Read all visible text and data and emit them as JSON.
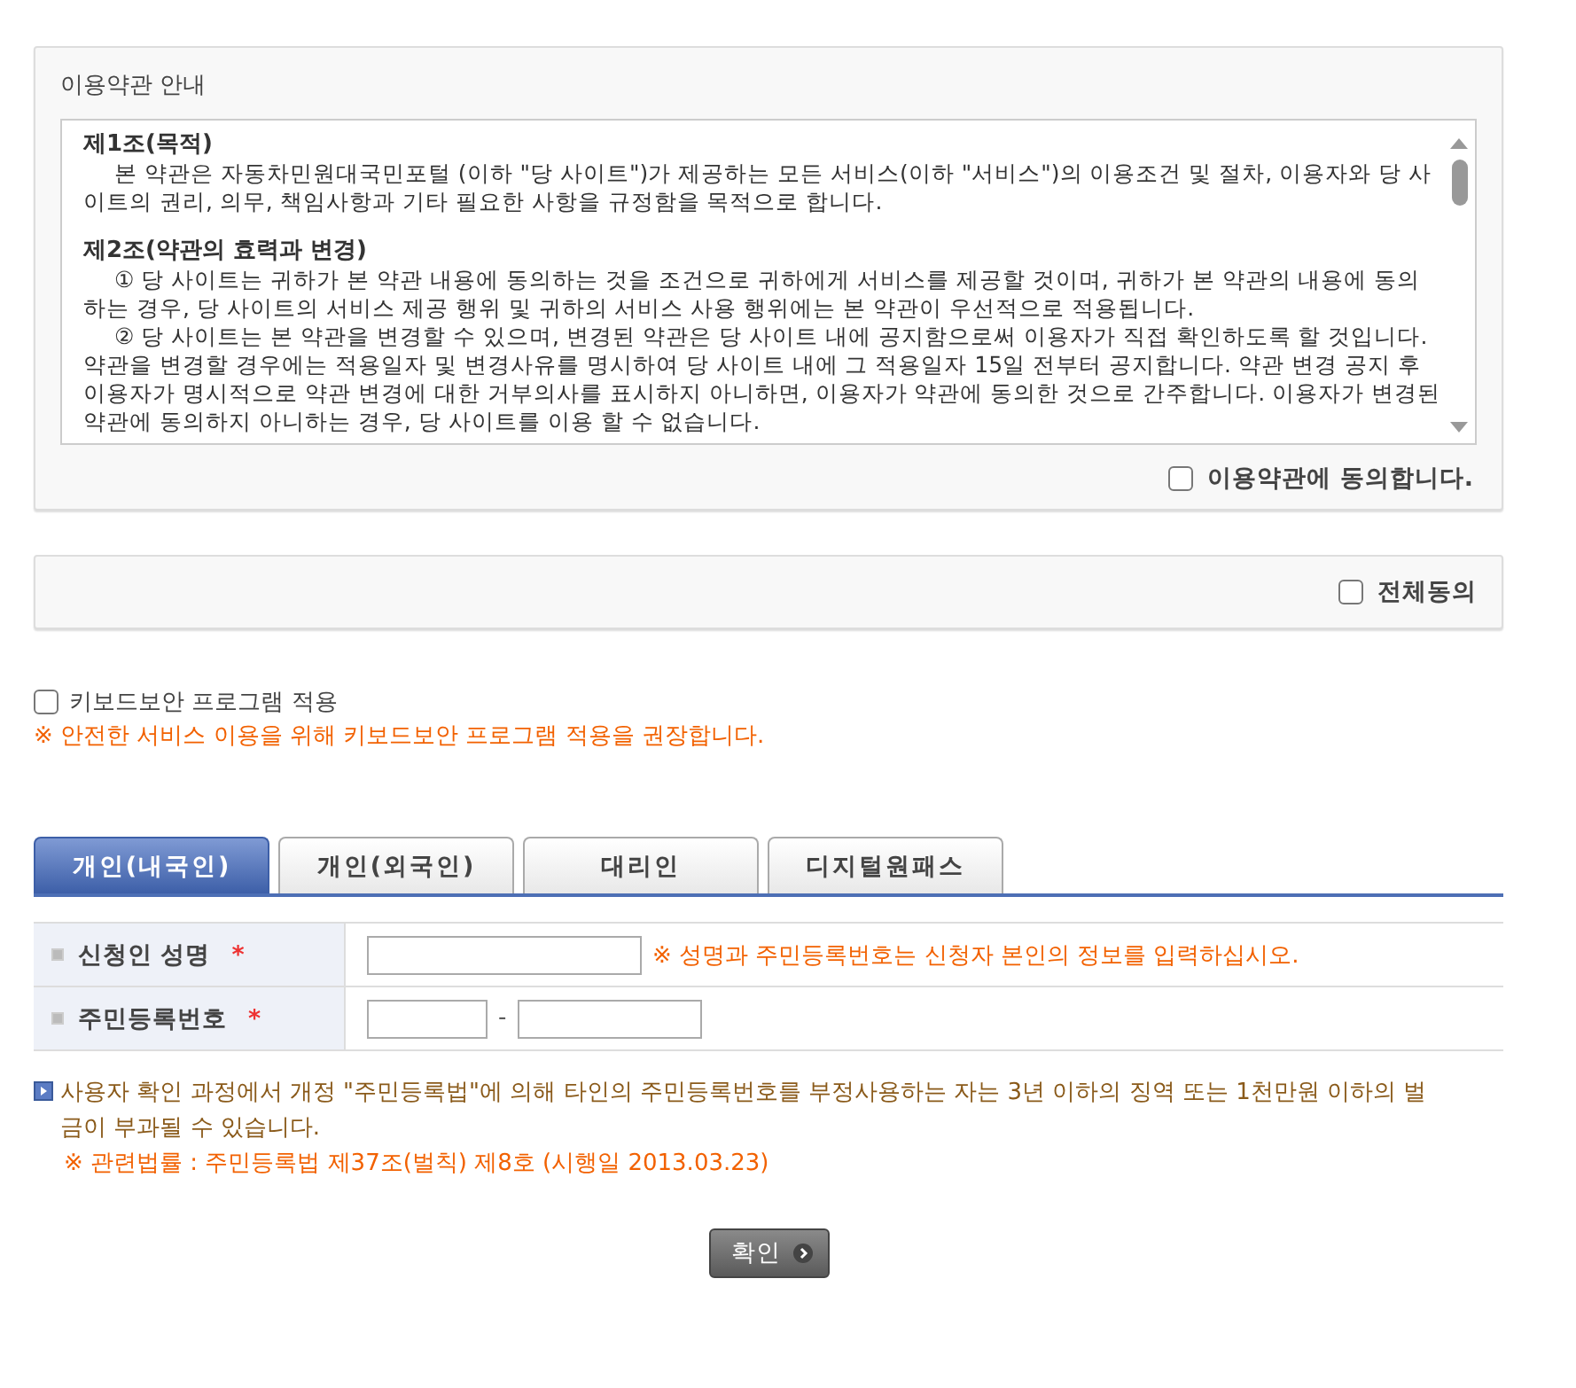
{
  "terms": {
    "title": "이용약관 안내",
    "articles": [
      {
        "heading": "제1조(목적)",
        "paragraphs": [
          "본 약관은 자동차민원대국민포털 (이하 \"당 사이트\")가 제공하는 모든 서비스(이하 \"서비스\")의 이용조건 및 절차, 이용자와 당 사이트의 권리, 의무, 책임사항과 기타 필요한 사항을 규정함을 목적으로 합니다."
        ]
      },
      {
        "heading": "제2조(약관의 효력과 변경)",
        "paragraphs": [
          "① 당 사이트는 귀하가 본 약관 내용에 동의하는 것을 조건으로 귀하에게 서비스를 제공할 것이며, 귀하가 본 약관의 내용에 동의하는 경우, 당 사이트의 서비스 제공 행위 및 귀하의 서비스 사용 행위에는 본 약관이 우선적으로 적용됩니다.",
          "② 당 사이트는 본 약관을 변경할 수 있으며, 변경된 약관은 당 사이트 내에 공지함으로써 이용자가 직접 확인하도록 할 것입니다. 약관을 변경할 경우에는 적용일자 및 변경사유를 명시하여 당 사이트 내에 그 적용일자 15일 전부터 공지합니다. 약관 변경 공지 후 이용자가 명시적으로 약관 변경에 대한 거부의사를 표시하지 아니하면, 이용자가 약관에 동의한 것으로 간주합니다. 이용자가 변경된 약관에 동의하지 아니하는 경우, 당 사이트를 이용 할 수 없습니다."
        ]
      }
    ],
    "agree": {
      "label": "이용약관에 동의합니다.",
      "checked": false
    }
  },
  "all_agree": {
    "label": "전체동의",
    "checked": false
  },
  "keyboard_security": {
    "label": "키보드보안 프로그램 적용",
    "checked": false,
    "note": "※ 안전한 서비스 이용을 위해 키보드보안 프로그램 적용을 권장합니다."
  },
  "tabs": [
    {
      "label": "개인(내국인)",
      "selected": true
    },
    {
      "label": "개인(외국인)",
      "selected": false
    },
    {
      "label": "대리인",
      "selected": false
    },
    {
      "label": "디지털원패스",
      "selected": false
    }
  ],
  "form": {
    "rows": [
      {
        "kind": "single",
        "label": "신청인 성명",
        "required_mark": "*",
        "hint": "※ 성명과 주민등록번호는 신청자 본인의 정보를 입력하십시오."
      },
      {
        "kind": "split",
        "label": "주민등록번호",
        "required_mark": "*",
        "separator": "-"
      }
    ]
  },
  "notice": {
    "text": "사용자 확인 과정에서 개정 \"주민등록법\"에 의해 타인의 주민등록번호를 부정사용하는 자는 3년 이하의 징역 또는 1천만원 이하의 벌금이 부과될 수 있습니다.",
    "law": "※ 관련법률 : 주민등록법 제37조(벌칙) 제8호 (시행일 2013.03.23)"
  },
  "confirm_button": {
    "label": "확인"
  }
}
